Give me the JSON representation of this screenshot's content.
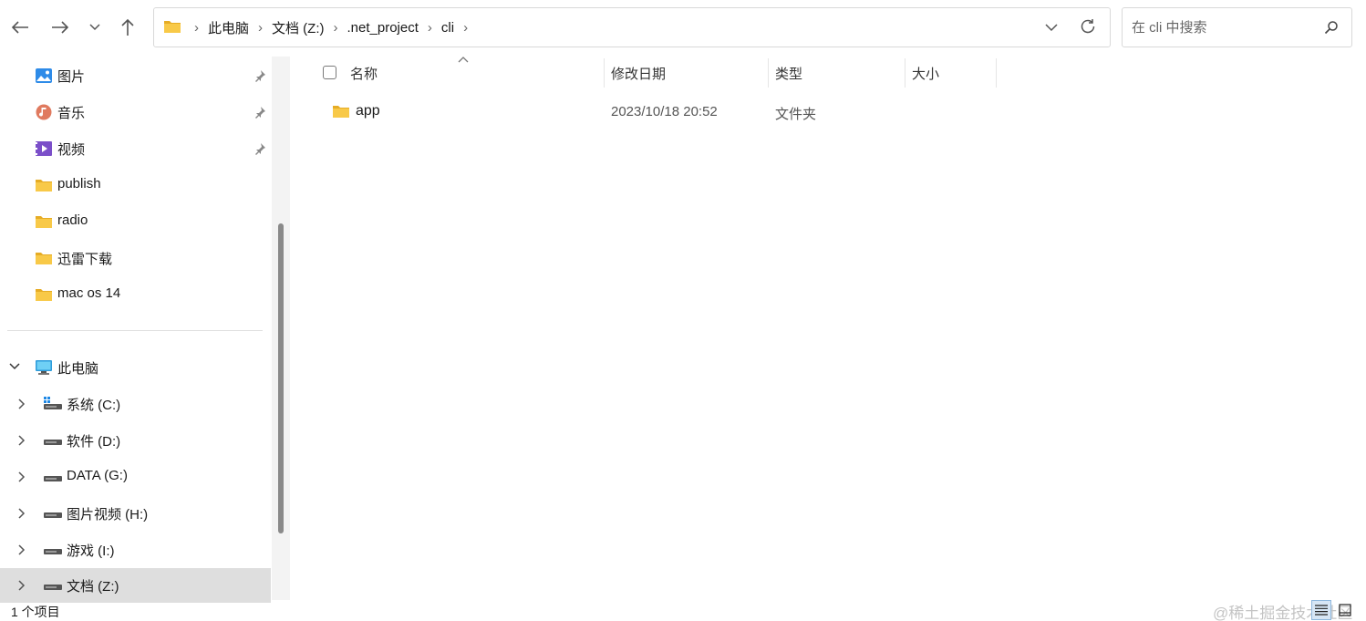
{
  "address": {
    "crumbs": [
      "此电脑",
      "文档 (Z:)",
      ".net_project",
      "cli"
    ]
  },
  "search": {
    "placeholder": "在 cli 中搜索"
  },
  "sidebar": {
    "quick_access": [
      {
        "label": "图片",
        "icon": "pictures-icon",
        "pinned": true
      },
      {
        "label": "音乐",
        "icon": "music-icon",
        "pinned": true
      },
      {
        "label": "视频",
        "icon": "videos-icon",
        "pinned": true
      },
      {
        "label": "publish",
        "icon": "folder-icon"
      },
      {
        "label": "radio",
        "icon": "folder-icon"
      },
      {
        "label": "迅雷下载",
        "icon": "folder-icon"
      },
      {
        "label": "mac os 14",
        "icon": "folder-icon"
      }
    ],
    "this_pc": {
      "label": "此电脑",
      "icon": "computer-icon"
    },
    "drives": [
      {
        "label": "系统 (C:)",
        "icon": "system-drive-icon"
      },
      {
        "label": "软件 (D:)",
        "icon": "drive-icon"
      },
      {
        "label": "DATA (G:)",
        "icon": "drive-icon"
      },
      {
        "label": "图片视频 (H:)",
        "icon": "drive-icon"
      },
      {
        "label": "游戏 (I:)",
        "icon": "drive-icon"
      },
      {
        "label": "文档 (Z:)",
        "icon": "drive-icon",
        "selected": true
      }
    ]
  },
  "columns": {
    "name": "名称",
    "modified": "修改日期",
    "type": "类型",
    "size": "大小"
  },
  "files": [
    {
      "name": "app",
      "modified": "2023/10/18 20:52",
      "type": "文件夹",
      "size": ""
    }
  ],
  "status": {
    "count": "1 个项目",
    "watermark": "@稀土掘金技术社区"
  },
  "colors": {
    "folder": "#f8c948",
    "folder_dark": "#e6ac25",
    "selected_bg": "#dedede",
    "accent": "#0067c0"
  }
}
